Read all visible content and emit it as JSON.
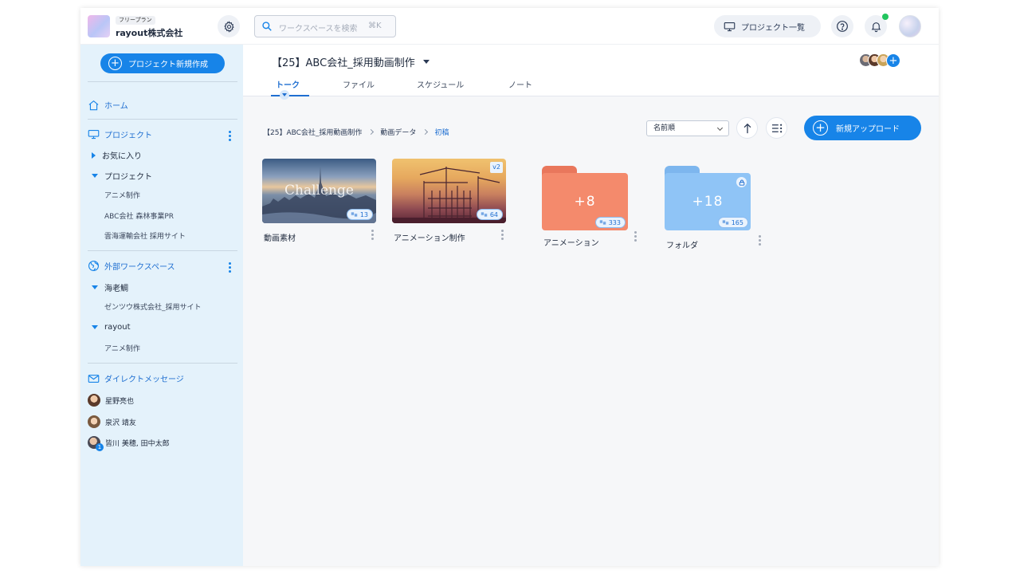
{
  "header": {
    "plan_label": "フリープラン",
    "company_name": "rayout株式会社",
    "search_placeholder": "ワークスペースを検索",
    "search_shortcut": "⌘K",
    "project_list_label": "プロジェクト一覧"
  },
  "sidebar": {
    "new_project_label": "プロジェクト新規作成",
    "home_label": "ホーム",
    "projects_section_label": "プロジェクト",
    "favorites_label": "お気に入り",
    "projects_group_label": "プロジェクト",
    "project_items": [
      "アニメ制作",
      "ABC会社 森林事業PR",
      "雲海運輸会社 採用サイト"
    ],
    "external_section_label": "外部ワークスペース",
    "external_groups": [
      {
        "name": "海老鯛",
        "items": [
          "ゼンツウ株式会社_採用サイト"
        ]
      },
      {
        "name": "rayout",
        "items": [
          "アニメ制作"
        ]
      }
    ],
    "dm_section_label": "ダイレクトメッセージ",
    "dm_items": [
      "星野亮也",
      "泉沢 靖友",
      "皆川 美穂, 田中太郎"
    ],
    "dm_group_badge": "1"
  },
  "project": {
    "title": "【25】ABC会社_採用動画制作",
    "tabs": [
      {
        "label": "トーク",
        "active": true
      },
      {
        "label": "ファイル",
        "active": false
      },
      {
        "label": "スケジュール",
        "active": false
      },
      {
        "label": "ノート",
        "active": false
      }
    ]
  },
  "files": {
    "breadcrumb": [
      "【25】ABC会社_採用動画制作",
      "動画データ",
      "初稿"
    ],
    "sort_label": "名前順",
    "upload_label": "新規アップロード",
    "items": [
      {
        "name": "動画素材",
        "kind": "video",
        "overlay_text": "Challenge",
        "comment_count": "13"
      },
      {
        "name": "アニメーション制作",
        "kind": "video",
        "version": "v2",
        "comment_count": "64"
      },
      {
        "name": "アニメーション",
        "kind": "folder",
        "folder_count": "+8",
        "comment_count": "333",
        "color": "#f48a6c"
      },
      {
        "name": "フォルダ",
        "kind": "folder",
        "folder_count": "+18",
        "comment_count": "165",
        "color": "#8fc4f6"
      }
    ]
  },
  "colors": {
    "accent": "#1784e8",
    "sidebar_bg": "#e4f2fb",
    "online": "#22c55e"
  }
}
